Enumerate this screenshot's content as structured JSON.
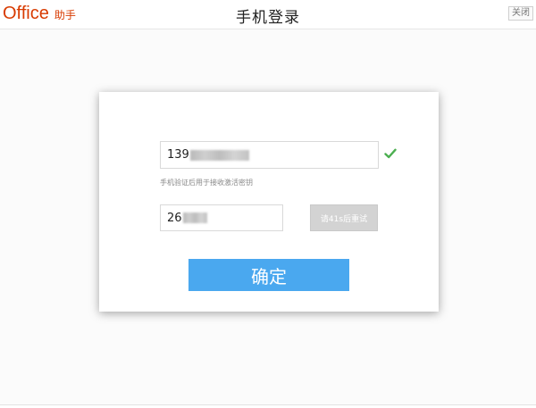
{
  "header": {
    "brand_office": "Office",
    "brand_helper": "助手",
    "title": "手机登录",
    "close_label": "关闭"
  },
  "form": {
    "phone_value": "139",
    "phone_hint": "手机验证后用于接收激活密钥",
    "code_value": "26",
    "retry_label": "请41s后重试",
    "confirm_label": "确定"
  },
  "colors": {
    "brand": "#d83b01",
    "primary": "#4aa8ef",
    "success": "#4caf50",
    "disabled": "#d3d3d3"
  },
  "icons": {
    "verified": "check-icon"
  }
}
